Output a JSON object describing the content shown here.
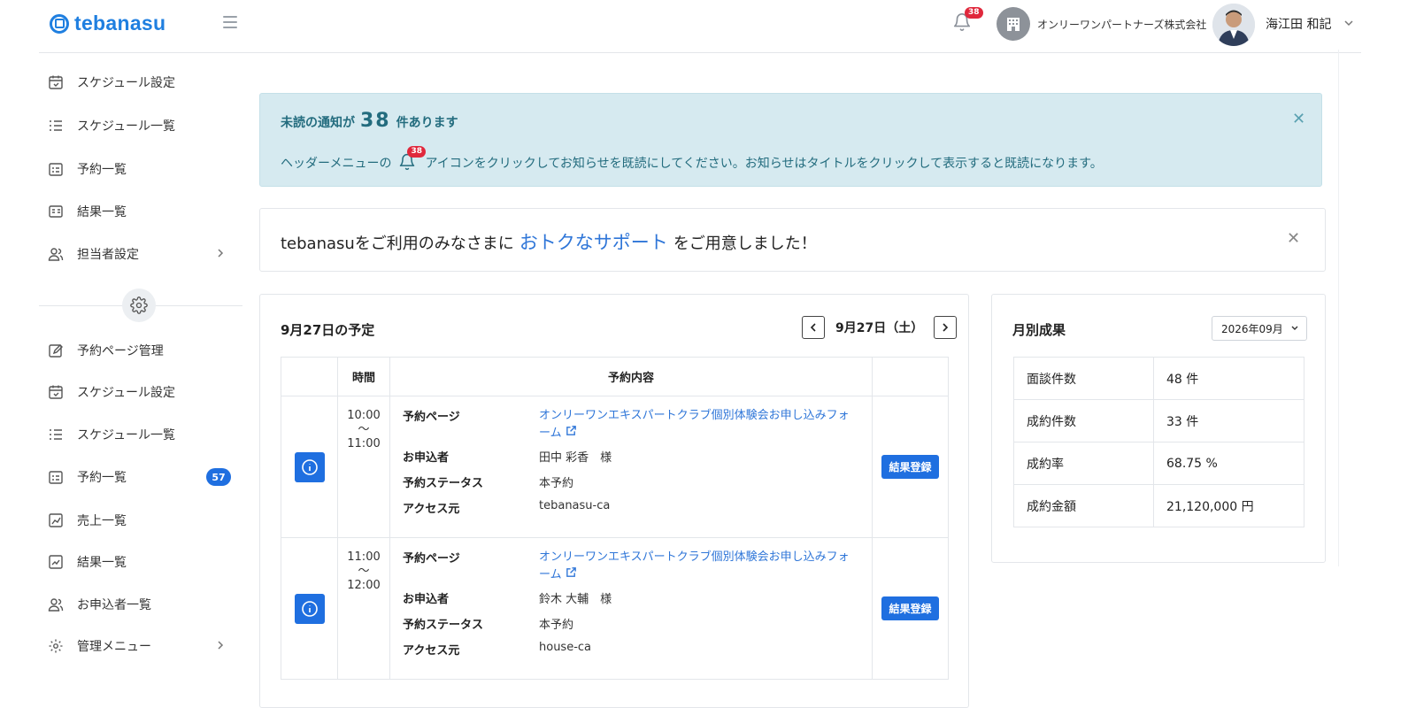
{
  "header": {
    "logo_text": "tebanasu",
    "notification_count": "38",
    "org_name": "オンリーワンパートナーズ株式会社",
    "user_name": "海江田 和記"
  },
  "sidebar": {
    "items_top": [
      {
        "label": "スケジュール設定",
        "icon": "calendar-icon"
      },
      {
        "label": "スケジュール一覧",
        "icon": "list-icon"
      },
      {
        "label": "予約一覧",
        "icon": "reservation-list-icon"
      },
      {
        "label": "結果一覧",
        "icon": "result-card-icon"
      },
      {
        "label": "担当者設定",
        "icon": "users-icon"
      }
    ],
    "items_bottom": [
      {
        "label": "予約ページ管理",
        "icon": "edit-page-icon"
      },
      {
        "label": "スケジュール設定",
        "icon": "calendar-check-icon"
      },
      {
        "label": "スケジュール一覧",
        "icon": "list-icon"
      },
      {
        "label": "予約一覧",
        "icon": "reservation-list-icon",
        "badge": "57"
      },
      {
        "label": "売上一覧",
        "icon": "sales-chart-icon"
      },
      {
        "label": "結果一覧",
        "icon": "result-chart-icon"
      },
      {
        "label": "お申込者一覧",
        "icon": "users-icon"
      },
      {
        "label": "管理メニュー",
        "icon": "gear-icon"
      }
    ]
  },
  "alert": {
    "title_prefix": "未読の通知が",
    "title_count": "38",
    "title_suffix": "件あります",
    "body_prefix": "ヘッダーメニューの",
    "body_badge": "38",
    "body_suffix": "アイコンをクリックしてお知らせを既読にしてください。お知らせはタイトルをクリックして表示すると既読になります。"
  },
  "promo": {
    "prefix": "tebanasuをご利用のみなさまに",
    "link": "おトクなサポート",
    "suffix": "をご用意しました！"
  },
  "schedule": {
    "title": "9月27日の予定",
    "date_label": "9月27日（土）",
    "columns": [
      "",
      "時間",
      "予約内容",
      ""
    ],
    "labels": {
      "page": "予約ページ",
      "applicant": "お申込者",
      "status": "予約ステータス",
      "source": "アクセス元"
    },
    "rows": [
      {
        "start": "10:00",
        "tilde": "〜",
        "end": "11:00",
        "page": "オンリーワンエキスパートクラブ個別体験会お申し込みフォーム",
        "applicant": "田中 彩香　様",
        "status": "本予約",
        "source": "tebanasu-ca",
        "action": "結果登録"
      },
      {
        "start": "11:00",
        "tilde": "〜",
        "end": "12:00",
        "page": "オンリーワンエキスパートクラブ個別体験会お申し込みフォーム",
        "applicant": "鈴木 大輔　様",
        "status": "本予約",
        "source": "house-ca",
        "action": "結果登録"
      }
    ]
  },
  "monthly": {
    "title": "月別成果",
    "month": "2026年09月",
    "rows": [
      {
        "label": "面談件数",
        "value": "48 件"
      },
      {
        "label": "成約件数",
        "value": "33 件"
      },
      {
        "label": "成約率",
        "value": "68.75 %"
      },
      {
        "label": "成約金額",
        "value": "21,120,000 円"
      }
    ]
  },
  "colors": {
    "accent": "#1f6fe0",
    "brand": "#1f7fe0",
    "alert_bg": "#d6eaf0",
    "alert_text": "#236c7e",
    "badge_red": "#e0283c"
  }
}
